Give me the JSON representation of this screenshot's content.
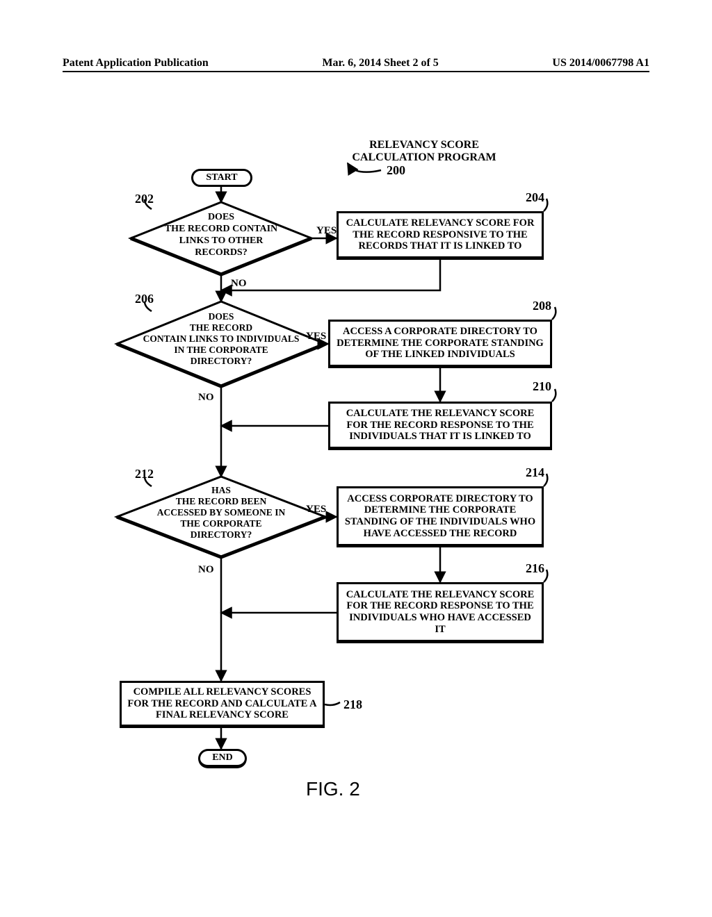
{
  "header": {
    "left": "Patent Application Publication",
    "center": "Mar. 6, 2014  Sheet 2 of 5",
    "right": "US 2014/0067798 A1"
  },
  "title_lines": [
    "RELEVANCY SCORE",
    "CALCULATION PROGRAM"
  ],
  "refs": {
    "r200": "200",
    "r202": "202",
    "r204": "204",
    "r206": "206",
    "r208": "208",
    "r210": "210",
    "r212": "212",
    "r214": "214",
    "r216": "216",
    "r218": "218"
  },
  "terminal": {
    "start": "START",
    "end": "END"
  },
  "decisions": {
    "d202": [
      "DOES",
      "THE RECORD CONTAIN",
      "LINKS TO OTHER",
      "RECORDS?"
    ],
    "d206": [
      "DOES",
      "THE RECORD",
      "CONTAIN LINKS TO INDIVIDUALS",
      "IN THE CORPORATE",
      "DIRECTORY?"
    ],
    "d212": [
      "HAS",
      "THE RECORD BEEN",
      "ACCESSED BY SOMEONE IN",
      "THE CORPORATE",
      "DIRECTORY?"
    ]
  },
  "yesno": {
    "yes": "YES",
    "no": "NO"
  },
  "boxes": {
    "b204": "CALCULATE RELEVANCY SCORE FOR THE RECORD RESPONSIVE TO THE RECORDS THAT IT IS LINKED TO",
    "b208": "ACCESS A CORPORATE DIRECTORY TO DETERMINE THE CORPORATE STANDING OF THE LINKED INDIVIDUALS",
    "b210": "CALCULATE THE RELEVANCY SCORE FOR THE RECORD RESPONSE TO THE INDIVIDUALS THAT IT IS LINKED TO",
    "b214": "ACCESS CORPORATE DIRECTORY TO DETERMINE THE CORPORATE STANDING OF THE INDIVIDUALS WHO HAVE ACCESSED THE RECORD",
    "b216": "CALCULATE THE RELEVANCY SCORE FOR THE RECORD RESPONSE TO THE INDIVIDUALS WHO HAVE ACCESSED IT",
    "b218": "COMPILE ALL RELEVANCY SCORES FOR THE RECORD AND CALCULATE A FINAL RELEVANCY SCORE"
  },
  "figure_label": "FIG. 2"
}
